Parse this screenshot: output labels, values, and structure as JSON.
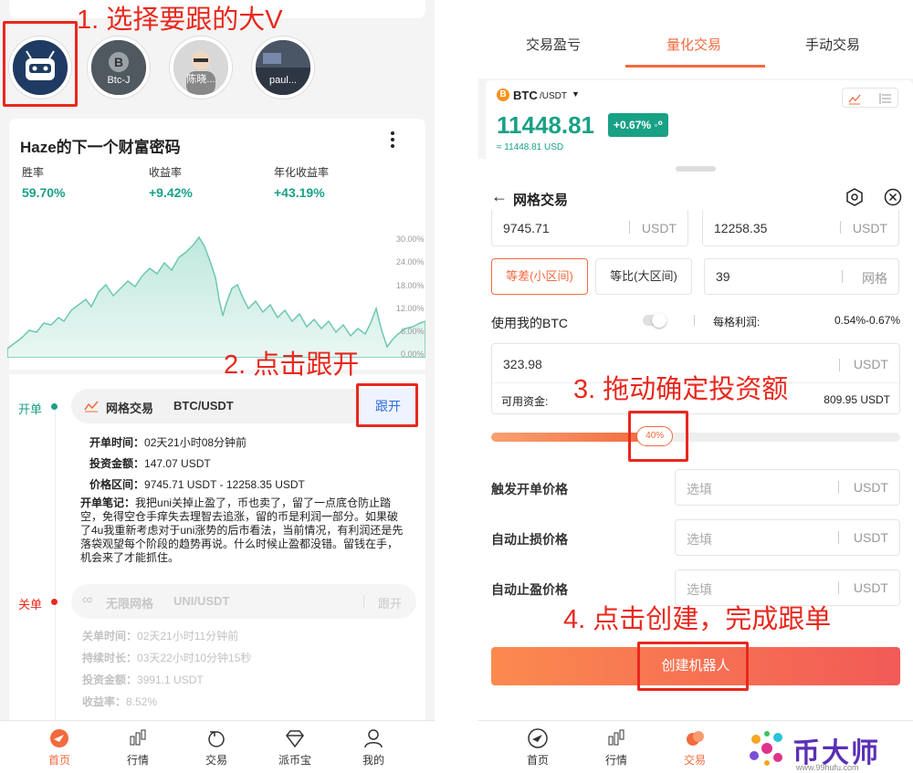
{
  "annotations": {
    "step1": "1. 选择要跟的大V",
    "step2": "2. 点击跟开",
    "step3": "3. 拖动确定投资额",
    "step4": "4. 点击创建，完成跟单"
  },
  "left": {
    "avatars": [
      "Btc-J",
      "陈晓...",
      "paul..."
    ],
    "profile": {
      "title": "Haze的下一个财富密码",
      "stats": [
        {
          "label": "胜率",
          "value": "59.70%"
        },
        {
          "label": "收益率",
          "value": "+9.42%"
        },
        {
          "label": "年化收益率",
          "value": "+43.19%"
        }
      ],
      "yticks": [
        "30.00%",
        "24.00%",
        "18.00%",
        "12.00%",
        "6.00%",
        "0.00%"
      ]
    },
    "open_trade": {
      "status": "开单",
      "strategy": "网格交易",
      "pair": "BTC/USDT",
      "follow_label": "跟开",
      "details": [
        {
          "k": "开单时间：",
          "v": "02天21小时08分钟前"
        },
        {
          "k": "投资金额：",
          "v": "147.07 USDT"
        },
        {
          "k": "价格区间：",
          "v": "9745.71 USDT - 12258.35 USDT"
        }
      ],
      "note_key": "开单笔记：",
      "note": "我把uni关掉止盈了，币也卖了，留了一点底仓防止踏空，免得空仓手痒失去理智去追涨，留的币是利润一部分。如果破了4u我重新考虑对于uni涨势的后市看法，当前情况，有利润还是先落袋观望每个阶段的趋势再说。什么时候止盈都没错。留钱在手，机会来了才能抓住。"
    },
    "closed_trade": {
      "status": "关单",
      "strategy": "无限网格",
      "pair": "UNI/USDT",
      "follow_label": "跟开",
      "details": [
        {
          "k": "关单时间：",
          "v": "02天21小时11分钟前"
        },
        {
          "k": "持续时长：",
          "v": "03天22小时10分钟15秒"
        },
        {
          "k": "投资金额：",
          "v": "3991.1 USDT"
        },
        {
          "k": "收益率：",
          "v": "8.52%"
        }
      ]
    },
    "tabs": [
      "首页",
      "行情",
      "交易",
      "派币宝",
      "我的"
    ]
  },
  "right": {
    "top_tabs": [
      "交易盈亏",
      "量化交易",
      "手动交易"
    ],
    "ticker": {
      "symbol": "BTC",
      "quote": "/USDT",
      "price": "11448.81",
      "change": "+0.67%",
      "usd": "≈ 11448.81 USD"
    },
    "sheet_title": "网格交易",
    "low_price": "9745.71",
    "high_price": "12258.35",
    "unit": "USDT",
    "mode_a": "等差(小区间)",
    "mode_b": "等比(大区间)",
    "grids": "39",
    "grid_unit": "网格",
    "use_btc": "使用我的BTC",
    "profit_label": "每格利润:",
    "profit_value": "0.54%-0.67%",
    "invest_amount": "323.98",
    "available_label": "可用资金:",
    "available_value": "809.95 USDT",
    "slider_label": "40%",
    "slider_percent": 40,
    "trigger_label": "触发开单价格",
    "stop_loss_label": "自动止损价格",
    "take_profit_label": "自动止盈价格",
    "placeholder": "选填",
    "create_label": "创建机器人",
    "tabs": [
      "首页",
      "行情",
      "交易",
      "我的"
    ]
  },
  "watermark": {
    "name": "币大师",
    "url": "www.99hufu.com"
  },
  "colors": {
    "red": "#e8281e",
    "green": "#19a186",
    "orange": "#f26a3d"
  }
}
